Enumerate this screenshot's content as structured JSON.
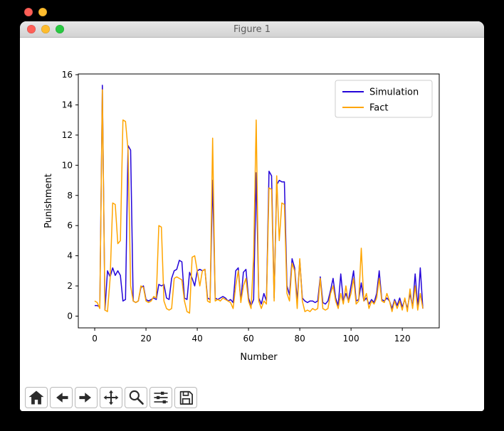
{
  "background": {
    "window_controls": [
      "close",
      "minimize"
    ]
  },
  "window": {
    "title": "Figure 1",
    "traffic_lights": [
      "close",
      "minimize",
      "zoom"
    ]
  },
  "toolbar": {
    "buttons": [
      {
        "name": "home",
        "icon": "home-icon"
      },
      {
        "name": "back",
        "icon": "back-arrow-icon"
      },
      {
        "name": "forward",
        "icon": "forward-arrow-icon"
      },
      {
        "name": "pan",
        "icon": "pan-arrows-icon"
      },
      {
        "name": "zoom",
        "icon": "magnifier-icon"
      },
      {
        "name": "configure-subplots",
        "icon": "sliders-icon"
      },
      {
        "name": "save",
        "icon": "floppy-disk-icon"
      }
    ]
  },
  "chart_data": {
    "type": "line",
    "title": "",
    "xlabel": "Number",
    "ylabel": "Punishment",
    "xlim": [
      -6.4,
      134.4
    ],
    "ylim": [
      -0.78,
      16.05
    ],
    "xticks": [
      0,
      20,
      40,
      60,
      80,
      100,
      120
    ],
    "yticks": [
      0,
      2,
      4,
      6,
      8,
      10,
      12,
      14,
      16
    ],
    "grid": false,
    "legend_position": "upper right",
    "x": [
      0,
      1,
      2,
      3,
      4,
      5,
      6,
      7,
      8,
      9,
      10,
      11,
      12,
      13,
      14,
      15,
      16,
      17,
      18,
      19,
      20,
      21,
      22,
      23,
      24,
      25,
      26,
      27,
      28,
      29,
      30,
      31,
      32,
      33,
      34,
      35,
      36,
      37,
      38,
      39,
      40,
      41,
      42,
      43,
      44,
      45,
      46,
      47,
      48,
      49,
      50,
      51,
      52,
      53,
      54,
      55,
      56,
      57,
      58,
      59,
      60,
      61,
      62,
      63,
      64,
      65,
      66,
      67,
      68,
      69,
      70,
      71,
      72,
      73,
      74,
      75,
      76,
      77,
      78,
      79,
      80,
      81,
      82,
      83,
      84,
      85,
      86,
      87,
      88,
      89,
      90,
      91,
      92,
      93,
      94,
      95,
      96,
      97,
      98,
      99,
      100,
      101,
      102,
      103,
      104,
      105,
      106,
      107,
      108,
      109,
      110,
      111,
      112,
      113,
      114,
      115,
      116,
      117,
      118,
      119,
      120,
      121,
      122,
      123,
      124,
      125,
      126,
      127,
      128
    ],
    "series": [
      {
        "name": "Simulation",
        "color": "#2404d9",
        "values": [
          0.7,
          0.7,
          0.6,
          15.3,
          0.4,
          3.0,
          2.6,
          3.2,
          2.7,
          3.0,
          2.7,
          1.0,
          1.1,
          11.3,
          11.0,
          1.0,
          0.9,
          1.0,
          1.9,
          2.0,
          1.1,
          1.0,
          1.1,
          1.2,
          1.1,
          2.1,
          2.0,
          2.1,
          1.2,
          1.1,
          2.5,
          3.0,
          3.1,
          3.7,
          3.6,
          1.2,
          1.1,
          2.9,
          2.5,
          2.0,
          3.0,
          3.1,
          3.0,
          3.1,
          1.2,
          1.1,
          9.0,
          1.2,
          1.1,
          1.2,
          1.3,
          1.2,
          1.0,
          1.1,
          0.9,
          3.0,
          3.2,
          1.0,
          2.9,
          3.1,
          1.2,
          0.7,
          1.1,
          9.5,
          1.2,
          0.8,
          1.5,
          1.0,
          9.6,
          9.3,
          1.2,
          8.7,
          9.0,
          8.9,
          8.9,
          2.0,
          1.4,
          3.8,
          3.2,
          1.0,
          3.7,
          1.2,
          1.0,
          0.9,
          1.0,
          1.0,
          0.9,
          1.0,
          2.6,
          0.9,
          0.8,
          1.0,
          1.7,
          2.5,
          1.2,
          0.7,
          2.8,
          1.0,
          1.5,
          1.0,
          2.0,
          3.0,
          1.0,
          1.1,
          2.2,
          1.0,
          1.2,
          0.8,
          1.1,
          0.9,
          1.5,
          3.0,
          1.1,
          1.0,
          1.2,
          1.0,
          0.5,
          1.1,
          0.7,
          1.2,
          0.6,
          1.1,
          0.5,
          1.5,
          0.6,
          2.8,
          0.6,
          3.2,
          0.5
        ]
      },
      {
        "name": "Fact",
        "color": "#ffa500",
        "values": [
          1.0,
          0.9,
          0.5,
          15.0,
          0.4,
          0.3,
          2.5,
          7.5,
          7.4,
          4.8,
          5.0,
          13.0,
          12.9,
          11.0,
          2.0,
          1.0,
          0.9,
          1.0,
          2.0,
          1.9,
          1.0,
          0.9,
          1.0,
          1.3,
          1.2,
          6.0,
          5.9,
          1.0,
          0.5,
          0.4,
          0.5,
          2.5,
          2.6,
          2.5,
          2.4,
          1.0,
          0.3,
          0.2,
          3.9,
          4.0,
          3.0,
          2.0,
          3.0,
          3.1,
          1.0,
          0.9,
          11.8,
          1.0,
          1.1,
          1.0,
          1.2,
          1.1,
          1.0,
          0.9,
          0.5,
          2.0,
          3.0,
          0.9,
          2.0,
          2.5,
          1.0,
          0.5,
          4.0,
          13.0,
          1.0,
          0.5,
          1.0,
          0.8,
          8.5,
          8.4,
          1.0,
          9.3,
          5.0,
          7.5,
          7.4,
          1.5,
          1.0,
          3.5,
          3.0,
          0.5,
          3.8,
          1.0,
          0.3,
          0.4,
          0.3,
          0.5,
          0.4,
          0.5,
          2.5,
          0.5,
          0.4,
          0.5,
          1.5,
          2.0,
          1.0,
          0.5,
          1.5,
          0.8,
          2.0,
          0.9,
          1.5,
          2.5,
          0.8,
          1.0,
          4.5,
          1.0,
          1.5,
          0.5,
          1.0,
          0.8,
          1.2,
          2.5,
          1.0,
          0.9,
          1.5,
          1.0,
          0.3,
          1.0,
          0.5,
          1.0,
          0.4,
          1.2,
          0.3,
          1.8,
          0.5,
          2.0,
          0.4,
          1.5,
          0.5
        ]
      }
    ]
  }
}
